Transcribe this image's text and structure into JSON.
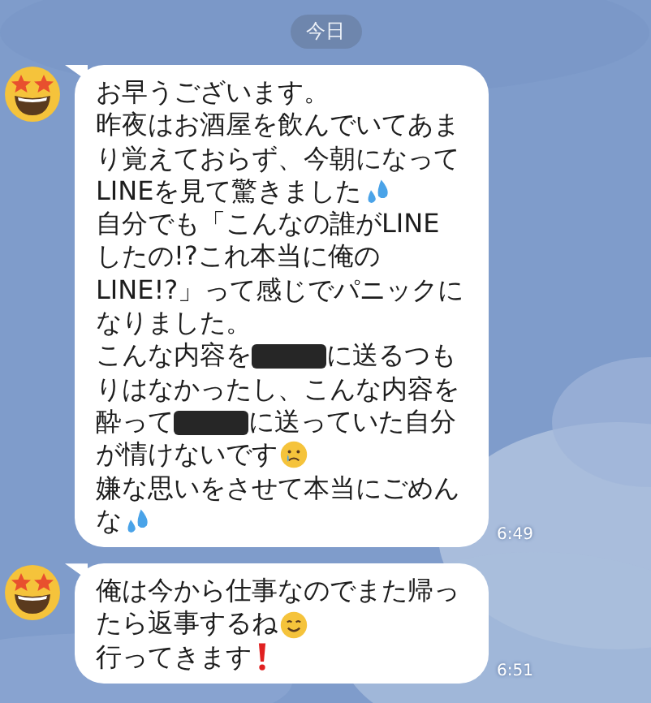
{
  "date_label": "今日",
  "messages": [
    {
      "time": "6:49",
      "lines": [
        [
          {
            "kind": "text",
            "text": "お早うございます。"
          }
        ],
        [
          {
            "kind": "text",
            "text": "昨夜はお酒屋を飲んでいてあま"
          }
        ],
        [
          {
            "kind": "text",
            "text": "り覚えておらず、今朝になって"
          }
        ],
        [
          {
            "kind": "text",
            "text": "LINEを見て驚きました"
          },
          {
            "kind": "sweat"
          }
        ],
        [
          {
            "kind": "text",
            "text": "自分でも「こんなの誰がLINE"
          }
        ],
        [
          {
            "kind": "text",
            "text": "したの!?これ本当に俺の"
          }
        ],
        [
          {
            "kind": "text",
            "text": "LINE!?」って感じでパニックに"
          }
        ],
        [
          {
            "kind": "text",
            "text": "なりました。"
          }
        ],
        [
          {
            "kind": "text",
            "text": "こんな内容を"
          },
          {
            "kind": "redacted"
          },
          {
            "kind": "text",
            "text": "に送るつも"
          }
        ],
        [
          {
            "kind": "text",
            "text": "りはなかったし、こんな内容を"
          }
        ],
        [
          {
            "kind": "text",
            "text": "酔って"
          },
          {
            "kind": "redacted"
          },
          {
            "kind": "text",
            "text": "に送っていた自分"
          }
        ],
        [
          {
            "kind": "text",
            "text": "が情けないです"
          },
          {
            "kind": "sad"
          }
        ],
        [
          {
            "kind": "text",
            "text": "嫌な思いをさせて本当にごめん"
          }
        ],
        [
          {
            "kind": "text",
            "text": "な"
          },
          {
            "kind": "sweat"
          }
        ]
      ]
    },
    {
      "time": "6:51",
      "lines": [
        [
          {
            "kind": "text",
            "text": "俺は今から仕事なのでまた帰っ"
          }
        ],
        [
          {
            "kind": "text",
            "text": "たら返事するね"
          },
          {
            "kind": "smile"
          }
        ],
        [
          {
            "kind": "text",
            "text": "行ってきます"
          },
          {
            "kind": "exclaim"
          }
        ]
      ]
    }
  ]
}
